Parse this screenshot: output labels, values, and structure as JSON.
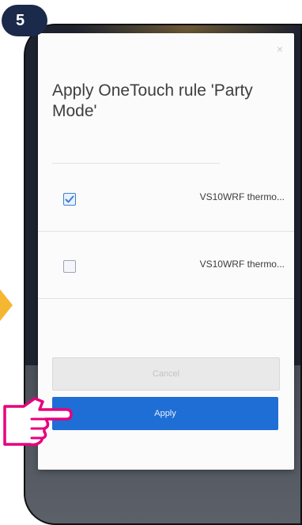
{
  "step": {
    "number": "5"
  },
  "dialog": {
    "close_symbol": "×",
    "title": "Apply OneTouch rule 'Party Mode'",
    "devices": [
      {
        "label": "VS10WRF thermo...",
        "checked": true
      },
      {
        "label": "VS10WRF thermo...",
        "checked": false
      }
    ],
    "cancel_label": "Cancel",
    "apply_label": "Apply"
  },
  "colors": {
    "badge": "#1b2a4a",
    "apply_button": "#1e6ed6",
    "checkbox_checked": "#3b7fd2",
    "arrow_hint": "#f5b731",
    "hand_outline": "#e6007e"
  },
  "icons": {
    "step_badge": "number-badge",
    "arrow_hint": "yellow-arrow",
    "close": "close-icon",
    "check": "checkmark-icon",
    "hand": "pointing-hand-icon"
  }
}
